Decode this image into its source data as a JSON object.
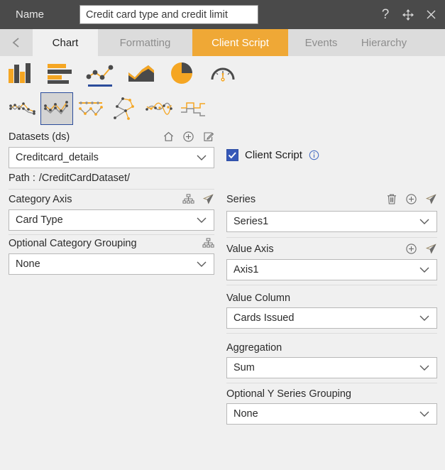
{
  "titlebar": {
    "name_label": "Name",
    "name_value": "Credit card type and credit limit",
    "help_icon": "help-question-icon",
    "move_icon": "move-arrows-icon",
    "close_icon": "close-icon"
  },
  "tabs": {
    "prev_arrow": "chevron-left-icon",
    "next_arrow": "chevron-right-icon",
    "items": [
      {
        "label": "Chart",
        "state": "active"
      },
      {
        "label": "Formatting",
        "state": "normal"
      },
      {
        "label": "Client Script",
        "state": "highlight"
      },
      {
        "label": "Events",
        "state": "normal"
      },
      {
        "label": "Hierarchy",
        "state": "normal"
      }
    ]
  },
  "chart_types": [
    {
      "name": "column-chart-icon",
      "selected": false
    },
    {
      "name": "bar-chart-icon",
      "selected": false
    },
    {
      "name": "line-chart-icon",
      "selected": true
    },
    {
      "name": "area-chart-icon",
      "selected": false
    },
    {
      "name": "pie-chart-icon",
      "selected": false
    },
    {
      "name": "gauge-chart-icon",
      "selected": false
    }
  ],
  "chart_subtypes": [
    {
      "name": "line-plain-icon",
      "selected": false
    },
    {
      "name": "line-marker-icon",
      "selected": true
    },
    {
      "name": "line-range-icon",
      "selected": false
    },
    {
      "name": "line-scatter-icon",
      "selected": false
    },
    {
      "name": "line-smooth-icon",
      "selected": false
    },
    {
      "name": "step-line-icon",
      "selected": false
    }
  ],
  "left_panel": {
    "datasets": {
      "label": "Datasets (ds)",
      "value": "Creditcard_details",
      "icons": [
        "home-icon",
        "plus-circle-icon",
        "edit-pencil-icon"
      ]
    },
    "path": {
      "label": "Path :",
      "value": "/CreditCardDataset/"
    },
    "category_axis": {
      "label": "Category Axis",
      "value": "Card Type",
      "icons": [
        "hierarchy-icon",
        "send-cursor-icon"
      ]
    },
    "category_grouping": {
      "label": "Optional Category Grouping",
      "value": "None",
      "icons": [
        "hierarchy-icon"
      ]
    }
  },
  "right_panel": {
    "client_script": {
      "label": "Client Script",
      "checked": true,
      "check_icon": "checkmark-icon",
      "info_icon": "info-circle-icon"
    },
    "series": {
      "label": "Series",
      "value": "Series1",
      "icons": [
        "trash-icon",
        "plus-circle-icon",
        "send-cursor-icon"
      ]
    },
    "value_axis": {
      "label": "Value Axis",
      "value": "Axis1",
      "icons": [
        "plus-circle-icon",
        "send-cursor-icon"
      ]
    },
    "value_column": {
      "label": "Value Column",
      "value": "Cards Issued"
    },
    "aggregation": {
      "label": "Aggregation",
      "value": "Sum"
    },
    "y_series_grouping": {
      "label": "Optional Y Series Grouping",
      "value": "None"
    }
  },
  "colors": {
    "titlebar_bg": "#4a4a4a",
    "tab_inactive_bg": "#dcdcdc",
    "tab_highlight_bg": "#efa836",
    "panel_bg": "#f0f0f0",
    "accent_orange": "#f5a623",
    "accent_blue": "#2b4c9b",
    "checkbox_blue": "#3658b8"
  }
}
